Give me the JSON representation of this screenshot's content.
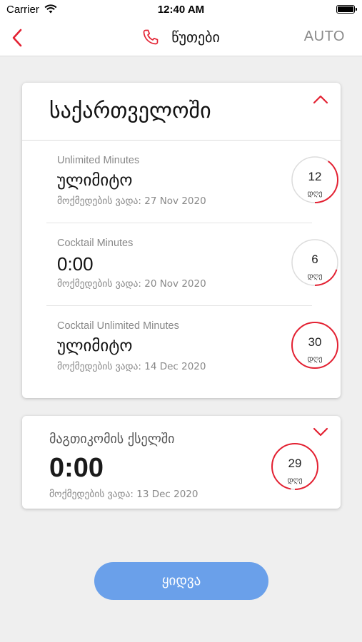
{
  "status_bar": {
    "carrier": "Carrier",
    "time": "12:40 AM"
  },
  "nav": {
    "title": "წუთები",
    "right_label": "AUTO"
  },
  "colors": {
    "accent": "#e32132",
    "button": "#6aa0ea",
    "ring_track": "#dcdcdc"
  },
  "georgia_section": {
    "title": "საქართველოში",
    "packages": [
      {
        "name": "Unlimited Minutes",
        "value": "ულიმიტო",
        "expiry": "მოქმედების ვადა: 27 Nov 2020",
        "days": "12",
        "days_unit": "დღე",
        "progress": 0.4
      },
      {
        "name": "Cocktail Minutes",
        "value": "0:00",
        "expiry": "მოქმედების ვადა: 20 Nov 2020",
        "days": "6",
        "days_unit": "დღე",
        "progress": 0.2
      },
      {
        "name": "Cocktail Unlimited Minutes",
        "value": "ულიმიტო",
        "expiry": "მოქმედების ვადა: 14 Dec 2020",
        "days": "30",
        "days_unit": "დღე",
        "progress": 1.0
      }
    ]
  },
  "network_section": {
    "name": "მაგთიკომის ქსელში",
    "value": "0:00",
    "expiry": "მოქმედების ვადა: 13 Dec 2020",
    "days": "29",
    "days_unit": "დღე",
    "progress": 0.97
  },
  "buy_button": {
    "label": "ყიდვა"
  }
}
